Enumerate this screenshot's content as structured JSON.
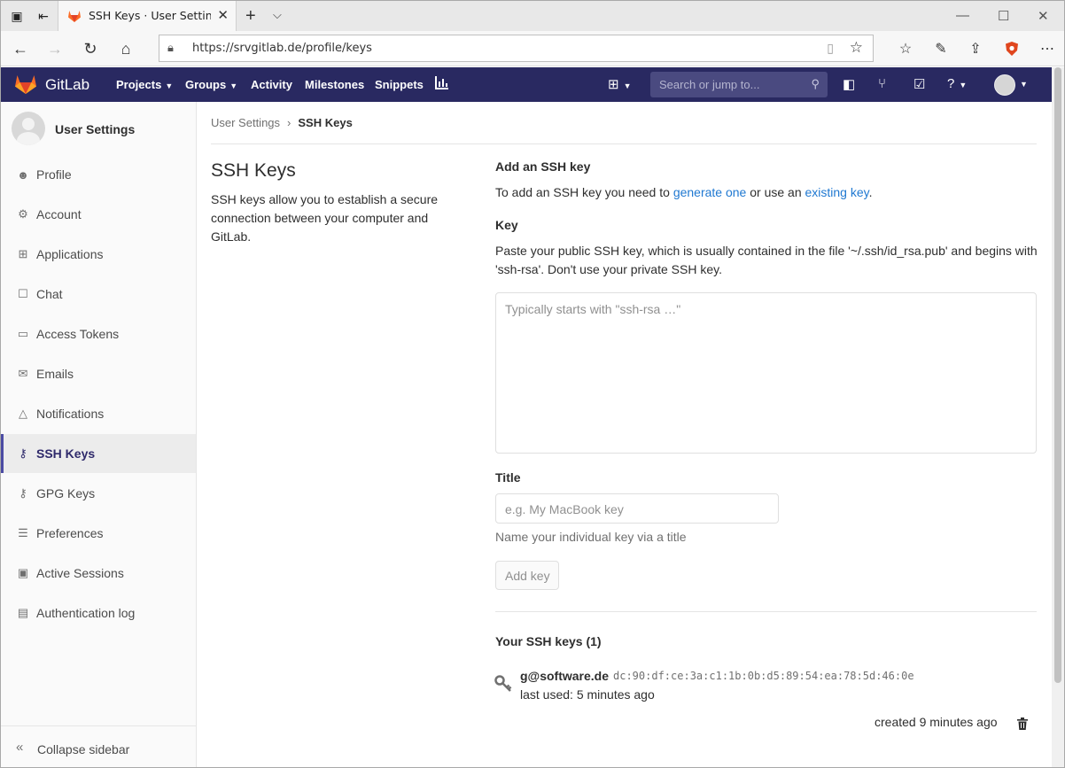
{
  "browser": {
    "tab_title": "SSH Keys · User Settings",
    "url": "https://srvgitlab.de/profile/keys"
  },
  "header": {
    "brand": "GitLab",
    "nav": [
      "Projects",
      "Groups",
      "Activity",
      "Milestones",
      "Snippets"
    ],
    "search_placeholder": "Search or jump to..."
  },
  "sidebar": {
    "title": "User Settings",
    "items": [
      {
        "label": "Profile",
        "icon": "profile-icon"
      },
      {
        "label": "Account",
        "icon": "account-icon"
      },
      {
        "label": "Applications",
        "icon": "applications-icon"
      },
      {
        "label": "Chat",
        "icon": "chat-icon"
      },
      {
        "label": "Access Tokens",
        "icon": "token-icon"
      },
      {
        "label": "Emails",
        "icon": "email-icon"
      },
      {
        "label": "Notifications",
        "icon": "bell-icon"
      },
      {
        "label": "SSH Keys",
        "icon": "key-icon"
      },
      {
        "label": "GPG Keys",
        "icon": "key-icon"
      },
      {
        "label": "Preferences",
        "icon": "sliders-icon"
      },
      {
        "label": "Active Sessions",
        "icon": "monitor-icon"
      },
      {
        "label": "Authentication log",
        "icon": "log-icon"
      }
    ],
    "active_index": 7,
    "collapse_label": "Collapse sidebar"
  },
  "breadcrumb": {
    "parent": "User Settings",
    "current": "SSH Keys"
  },
  "page": {
    "title": "SSH Keys",
    "description": "SSH keys allow you to establish a secure connection between your computer and GitLab."
  },
  "form": {
    "heading": "Add an SSH key",
    "intro_before": "To add an SSH key you need to ",
    "intro_link1": "generate one",
    "intro_middle": " or use an ",
    "intro_link2": "existing key",
    "intro_after": ".",
    "key_label": "Key",
    "key_help": "Paste your public SSH key, which is usually contained in the file '~/.ssh/id_rsa.pub' and begins with 'ssh-rsa'. Don't use your private SSH key.",
    "key_placeholder": "Typically starts with \"ssh-rsa …\"",
    "title_label": "Title",
    "title_placeholder": "e.g. My MacBook key",
    "title_help": "Name your individual key via a title",
    "submit_label": "Add key"
  },
  "keys": {
    "heading": "Your SSH keys (1)",
    "list": [
      {
        "title": "g@software.de",
        "fingerprint": "dc:90:df:ce:3a:c1:1b:0b:d5:89:54:ea:78:5d:46:0e",
        "last_used": "last used: 5 minutes ago",
        "created": "created 9 minutes ago"
      }
    ]
  },
  "colors": {
    "header_bg": "#292961",
    "link": "#1f78d1",
    "active_accent": "#4b4ba3",
    "gitlab_orange": "#fc6d26"
  }
}
